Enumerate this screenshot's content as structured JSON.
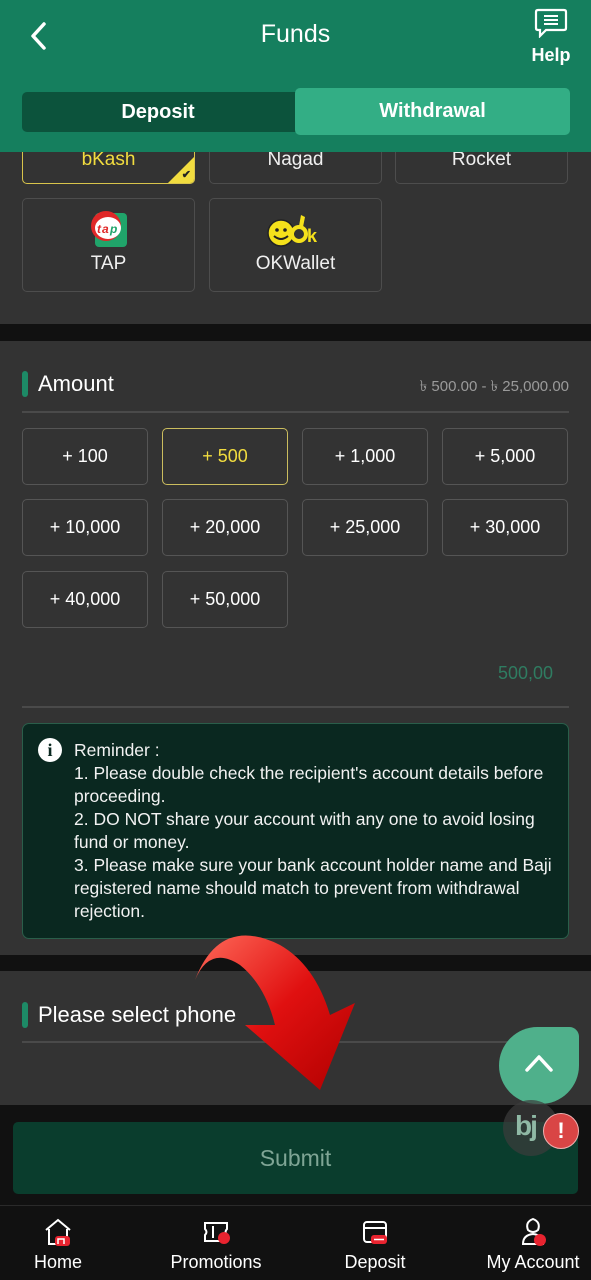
{
  "header": {
    "title": "Funds",
    "help_label": "Help",
    "tabs": [
      {
        "label": "Deposit",
        "active": false
      },
      {
        "label": "Withdrawal",
        "active": true
      }
    ],
    "brand_color": "#157f5e"
  },
  "payment_methods": [
    {
      "label": "bKash",
      "selected": true
    },
    {
      "label": "Nagad",
      "selected": false
    },
    {
      "label": "Rocket",
      "selected": false
    },
    {
      "label": "TAP",
      "selected": false,
      "logo": "tap-logo"
    },
    {
      "label": "OKWallet",
      "selected": false,
      "logo": "okwallet-logo"
    }
  ],
  "amount": {
    "title": "Amount",
    "range": "৳ 500.00 - ৳ 25,000.00",
    "presets": [
      "+ 100",
      "+ 500",
      "+ 1,000",
      "+ 5,000",
      "+ 10,000",
      "+ 20,000",
      "+ 25,000",
      "+ 30,000",
      "+ 40,000",
      "+ 50,000"
    ],
    "active_preset": "+ 500",
    "value": "500,00"
  },
  "reminder": {
    "title": "Reminder :",
    "lines": [
      "1. Please double check the recipient's account details before proceeding.",
      "2. DO NOT share your account with any one to avoid losing fund or money.",
      "3. Please make sure your bank account holder name and Baji registered name should match to prevent from withdrawal rejection."
    ]
  },
  "phone": {
    "title": "Please select phone"
  },
  "submit_label": "Submit",
  "floating": {
    "bj_label": "bj",
    "alert_label": "!"
  },
  "nav": [
    {
      "label": "Home",
      "icon": "home-icon"
    },
    {
      "label": "Promotions",
      "icon": "ticket-icon"
    },
    {
      "label": "Deposit",
      "icon": "wallet-icon"
    },
    {
      "label": "My Account",
      "icon": "account-icon"
    }
  ]
}
